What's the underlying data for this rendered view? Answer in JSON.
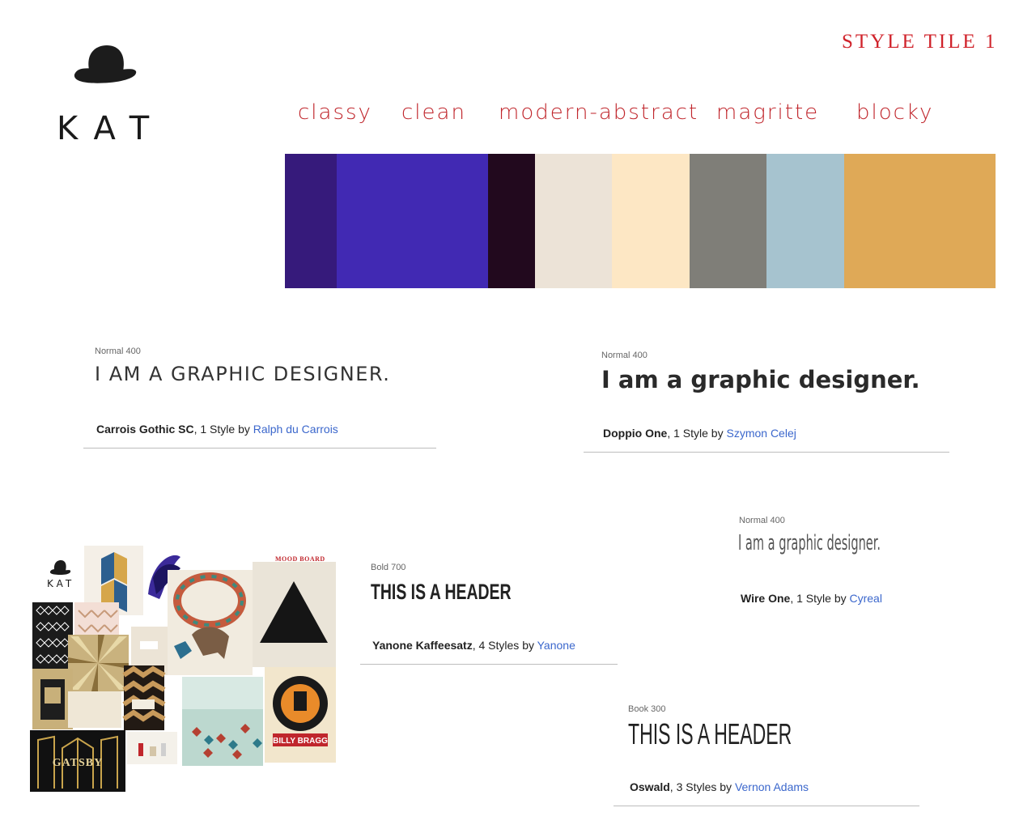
{
  "logo": {
    "text": "KAT",
    "icon": "bowler-hat-icon"
  },
  "title": "STYLE TILE 1",
  "keywords": [
    "classy",
    "clean",
    "modern-abstract",
    "magritte",
    "blocky"
  ],
  "palette": {
    "swatches": [
      "#361a7b",
      "#4129b3",
      "#22091e",
      "#ece3d7",
      "#fde7c4",
      "#7f7e78",
      "#a6c3cf",
      "#dfa957"
    ],
    "swatch_widths_note": ""
  },
  "specimens": [
    {
      "meta": "Normal 400",
      "sample": "I AM A GRAPHIC DESIGNER.",
      "font": "Carrois Gothic SC",
      "styles": ", 1 Style by ",
      "author": "Ralph du Carrois"
    },
    {
      "meta": "Normal 400",
      "sample": "I am a graphic designer.",
      "font": "Doppio One",
      "styles": ", 1 Style by ",
      "author": "Szymon Celej"
    },
    {
      "meta": "Normal 400",
      "sample": "I am a graphic designer.",
      "font": "Wire One",
      "styles": ", 1 Style by ",
      "author": "Cyreal"
    },
    {
      "meta": "Bold 700",
      "sample": "THIS IS A HEADER",
      "font": "Yanone Kaffeesatz",
      "styles": ", 4 Styles by ",
      "author": "Yanone"
    },
    {
      "meta": "Book 300",
      "sample": "THIS IS A HEADER",
      "font": "Oswald",
      "styles": ", 3 Styles by ",
      "author": "Vernon Adams"
    }
  ],
  "moodboard": {
    "label": "MOOD BOARD",
    "logo_text": "KAT",
    "poster_title": "GATSBY",
    "poster2_text": "BILLY BRAGG"
  }
}
